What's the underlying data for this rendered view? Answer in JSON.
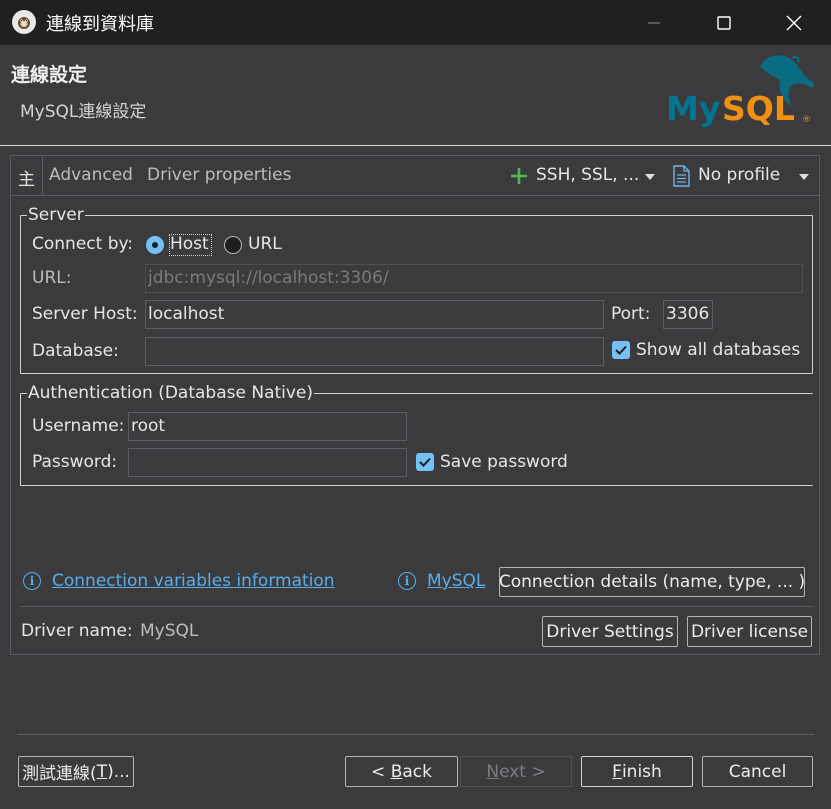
{
  "window": {
    "title": "連線到資料庫",
    "minimize_icon": "minimize-icon",
    "maximize_icon": "maximize-icon",
    "close_icon": "close-icon"
  },
  "header": {
    "title": "連線設定",
    "subtitle": "MySQL連線設定",
    "logo_text": "MySQL",
    "logo_colors": {
      "my": "#00758f",
      "sql": "#f29111"
    }
  },
  "tabs": [
    {
      "label": "主",
      "active": true
    },
    {
      "label": "Advanced",
      "active": false
    },
    {
      "label": "Driver properties",
      "active": false
    }
  ],
  "toolbar": {
    "ssh_label": "SSH, SSL, ...",
    "profile_label": "No profile"
  },
  "server": {
    "group_label": "Server",
    "connect_by_label": "Connect by:",
    "host_option": "Host",
    "url_option": "URL",
    "selected": "Host",
    "url_label": "URL:",
    "url_value": "jdbc:mysql://localhost:3306/",
    "host_label": "Server Host:",
    "host_value": "localhost",
    "port_label": "Port:",
    "port_value": "3306",
    "database_label": "Database:",
    "database_value": "",
    "show_all_label": "Show all databases",
    "show_all_checked": true
  },
  "auth": {
    "group_label": "Authentication (Database Native)",
    "username_label": "Username:",
    "username_value": "root",
    "password_label": "Password:",
    "password_value": "",
    "save_password_label": "Save password",
    "save_password_checked": true
  },
  "links": {
    "conn_vars": "Connection variables information",
    "mysql": "MySQL",
    "conn_details_button": "Connection details (name, type, ... )"
  },
  "driver": {
    "name_label": "Driver name:",
    "name_value": "MySQL",
    "settings_button": "Driver Settings",
    "license_button": "Driver license"
  },
  "footer": {
    "test_button_pre": "測試連線(",
    "test_button_mn": "T",
    "test_button_post": ")...",
    "back_button_pre": "< ",
    "back_button_mn": "B",
    "back_button_post": "ack",
    "next_button_mn": "N",
    "next_button_post": "ext >",
    "finish_button_mn": "F",
    "finish_button_post": "inish",
    "cancel_button": "Cancel"
  },
  "colors": {
    "accent": "#75c1f5",
    "link": "#5aaee8",
    "ssh_plus": "#4fb84f"
  }
}
